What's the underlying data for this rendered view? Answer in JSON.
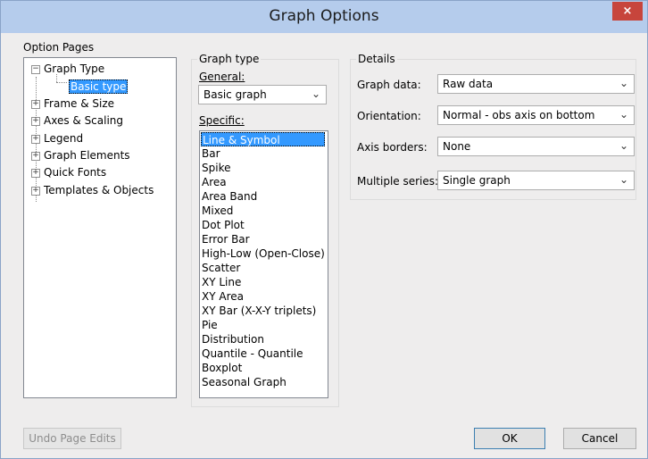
{
  "window": {
    "title": "Graph Options",
    "close": "×"
  },
  "option_pages": {
    "label": "Option Pages",
    "items": [
      {
        "label": "Graph Type",
        "expander": "−"
      },
      {
        "label": "Basic type"
      },
      {
        "label": "Frame & Size",
        "expander": "+"
      },
      {
        "label": "Axes & Scaling",
        "expander": "+"
      },
      {
        "label": "Legend",
        "expander": "+"
      },
      {
        "label": "Graph Elements",
        "expander": "+"
      },
      {
        "label": "Quick Fonts",
        "expander": "+"
      },
      {
        "label": "Templates & Objects",
        "expander": "+"
      }
    ]
  },
  "graph_type": {
    "label": "Graph type",
    "general_label": "General:",
    "general_value": "Basic graph",
    "specific_label": "Specific:",
    "specific_items": [
      "Line & Symbol",
      "Bar",
      "Spike",
      "Area",
      "Area Band",
      "Mixed",
      "Dot Plot",
      "Error Bar",
      "High-Low (Open-Close)",
      "Scatter",
      "XY Line",
      "XY Area",
      "XY Bar (X-X-Y triplets)",
      "Pie",
      "Distribution",
      "Quantile - Quantile",
      "Boxplot",
      "Seasonal Graph"
    ]
  },
  "details": {
    "label": "Details",
    "graph_data_label": "Graph data:",
    "graph_data_value": "Raw data",
    "orientation_label": "Orientation:",
    "orientation_value": "Normal - obs axis on bottom",
    "axis_borders_label": "Axis borders:",
    "axis_borders_value": "None",
    "multiple_series_label": "Multiple series:",
    "multiple_series_value": "Single graph"
  },
  "buttons": {
    "undo": "Undo Page Edits",
    "ok": "OK",
    "cancel": "Cancel"
  },
  "icons": {
    "dropdown": "chevron-down-icon",
    "expand": "plus-box-icon",
    "collapse": "minus-box-icon"
  },
  "colors": {
    "titlebar": "#b5ccec",
    "close": "#c7453c",
    "selection": "#3399ff"
  }
}
